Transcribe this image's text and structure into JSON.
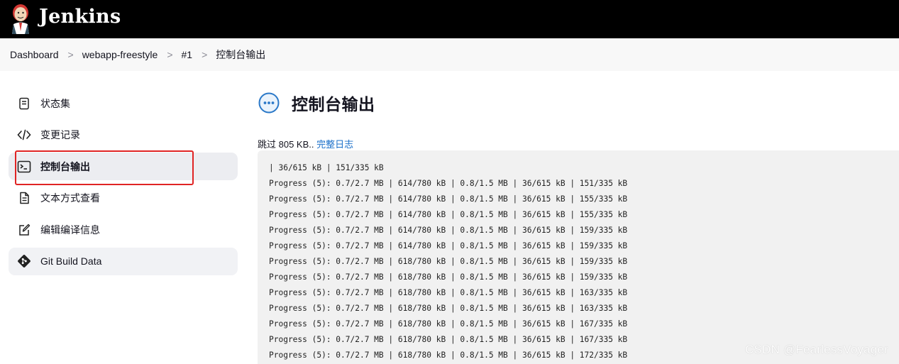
{
  "header": {
    "app_name": "Jenkins"
  },
  "breadcrumb": {
    "items": [
      "Dashboard",
      "webapp-freestyle",
      "#1",
      "控制台输出"
    ],
    "separator": ">"
  },
  "sidebar": {
    "items": [
      {
        "label": "状态集",
        "icon": "document-icon"
      },
      {
        "label": "变更记录",
        "icon": "code-icon"
      },
      {
        "label": "控制台输出",
        "icon": "terminal-icon",
        "active": true
      },
      {
        "label": "文本方式查看",
        "icon": "text-file-icon"
      },
      {
        "label": "编辑编译信息",
        "icon": "edit-icon"
      },
      {
        "label": "Git Build Data",
        "icon": "git-icon"
      }
    ]
  },
  "main": {
    "title": "控制台输出",
    "skip_text": "跳过 805 KB.. ",
    "full_log_link": "完整日志",
    "console_lines": [
      "| 36/615 kB | 151/335 kB",
      "Progress (5): 0.7/2.7 MB | 614/780 kB | 0.8/1.5 MB | 36/615 kB | 151/335 kB",
      "Progress (5): 0.7/2.7 MB | 614/780 kB | 0.8/1.5 MB | 36/615 kB | 155/335 kB",
      "Progress (5): 0.7/2.7 MB | 614/780 kB | 0.8/1.5 MB | 36/615 kB | 155/335 kB",
      "Progress (5): 0.7/2.7 MB | 614/780 kB | 0.8/1.5 MB | 36/615 kB | 159/335 kB",
      "Progress (5): 0.7/2.7 MB | 614/780 kB | 0.8/1.5 MB | 36/615 kB | 159/335 kB",
      "Progress (5): 0.7/2.7 MB | 618/780 kB | 0.8/1.5 MB | 36/615 kB | 159/335 kB",
      "Progress (5): 0.7/2.7 MB | 618/780 kB | 0.8/1.5 MB | 36/615 kB | 159/335 kB",
      "Progress (5): 0.7/2.7 MB | 618/780 kB | 0.8/1.5 MB | 36/615 kB | 163/335 kB",
      "Progress (5): 0.7/2.7 MB | 618/780 kB | 0.8/1.5 MB | 36/615 kB | 163/335 kB",
      "Progress (5): 0.7/2.7 MB | 618/780 kB | 0.8/1.5 MB | 36/615 kB | 167/335 kB",
      "Progress (5): 0.7/2.7 MB | 618/780 kB | 0.8/1.5 MB | 36/615 kB | 167/335 kB",
      "Progress (5): 0.7/2.7 MB | 618/780 kB | 0.8/1.5 MB | 36/615 kB | 172/335 kB"
    ]
  },
  "watermark": "CSDN @FearlessVoyager",
  "colors": {
    "header_bg": "#000000",
    "link": "#1a6fc9",
    "highlight": "#e02424",
    "console_bg": "#f1f1f1"
  }
}
